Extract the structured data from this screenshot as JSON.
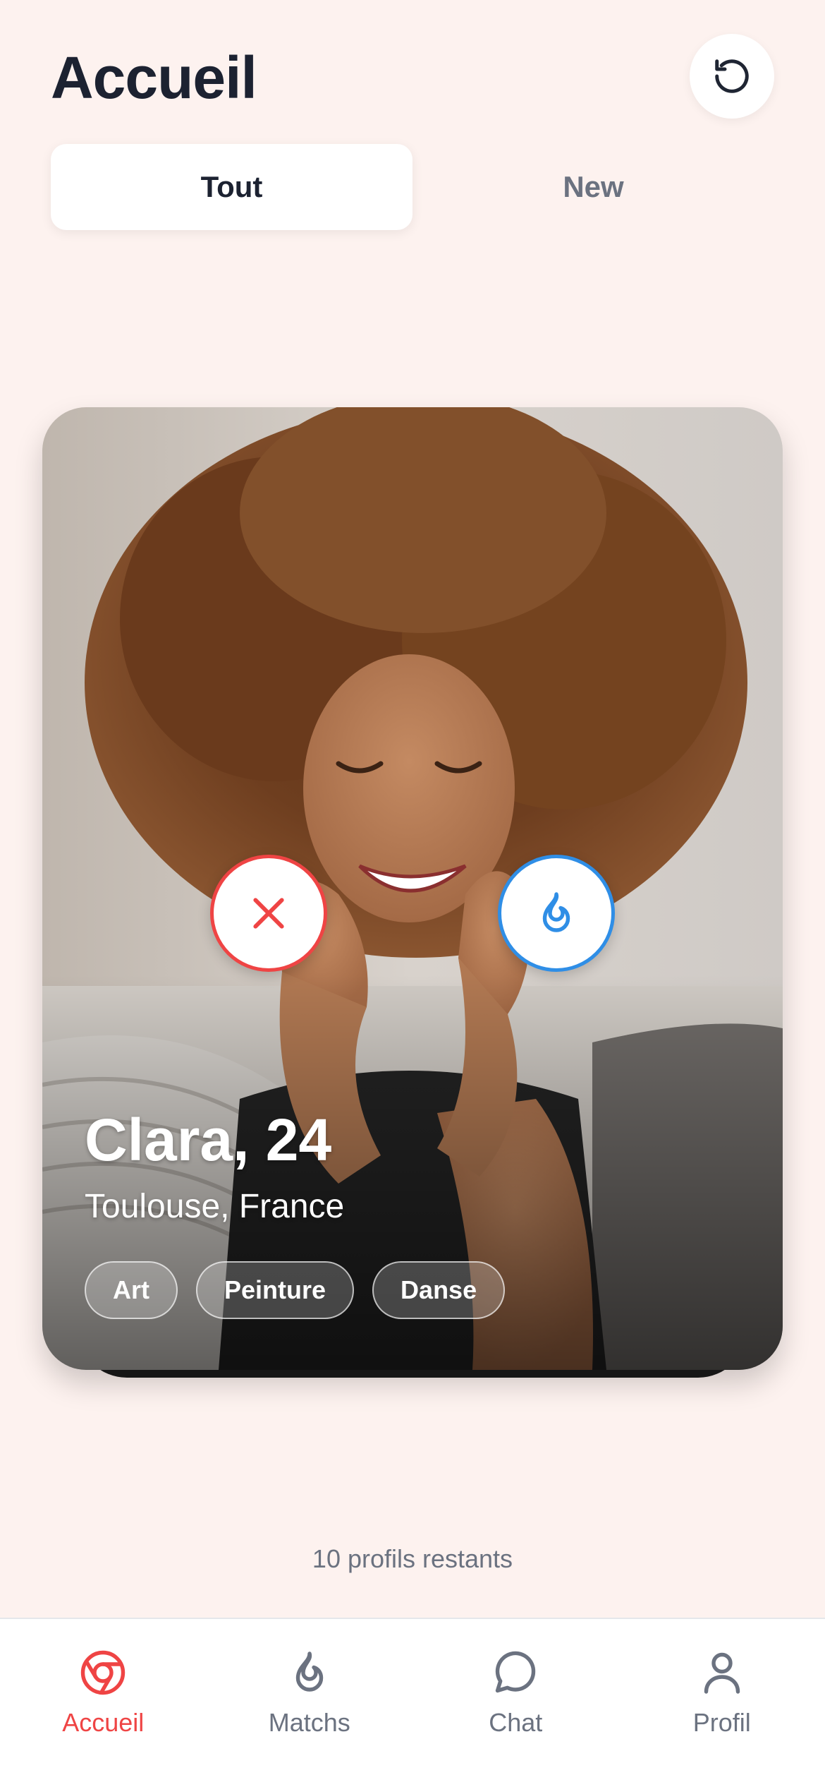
{
  "header": {
    "title": "Accueil",
    "refresh_icon": "refresh-icon"
  },
  "tabs": [
    {
      "label": "Tout",
      "active": true
    },
    {
      "label": "New",
      "active": false
    }
  ],
  "card": {
    "name_age": "Clara, 24",
    "location": "Toulouse, France",
    "interests": [
      "Art",
      "Peinture",
      "Danse"
    ],
    "dislike_icon": "close-icon",
    "like_icon": "flame-icon"
  },
  "remaining_text": "10 profils restants",
  "nav": [
    {
      "label": "Accueil",
      "icon": "home-logo-icon",
      "active": true
    },
    {
      "label": "Matchs",
      "icon": "flame-icon",
      "active": false
    },
    {
      "label": "Chat",
      "icon": "chat-bubble-icon",
      "active": false
    },
    {
      "label": "Profil",
      "icon": "user-icon",
      "active": false
    }
  ],
  "colors": {
    "background": "#fdf2ef",
    "accent_red": "#ef4444",
    "accent_blue": "#2f8ee6",
    "text_dark": "#1c2231",
    "text_muted": "#6b7280"
  }
}
